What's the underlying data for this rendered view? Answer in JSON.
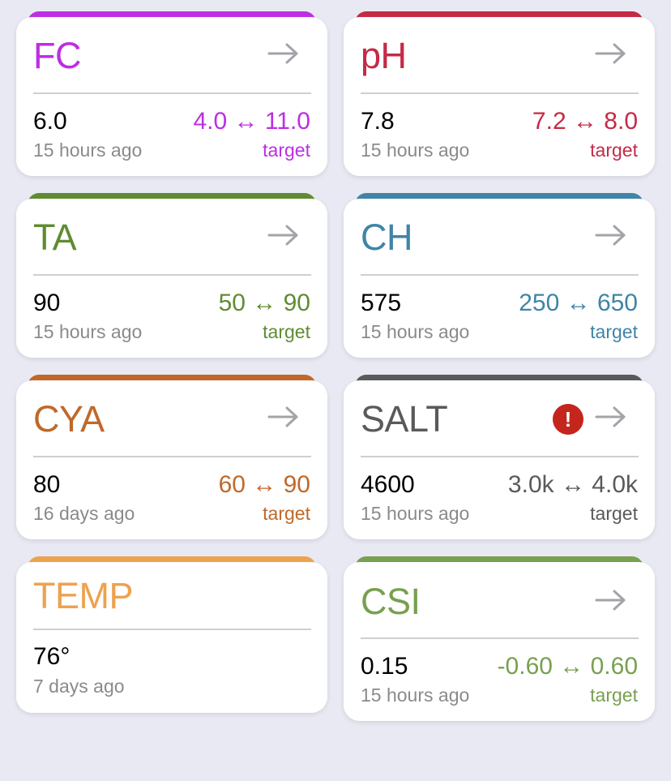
{
  "cards": [
    {
      "title": "FC",
      "value": "6.0",
      "ago": "15 hours ago",
      "range": "4.0 ↔ 11.0",
      "target": "target",
      "color": "#bd2ee4",
      "arrow_icon": "arrow-right-icon"
    },
    {
      "title": "pH",
      "value": "7.8",
      "ago": "15 hours ago",
      "range": "7.2 ↔ 8.0",
      "target": "target",
      "color": "#c42a46",
      "arrow_icon": "arrow-right-icon"
    },
    {
      "title": "TA",
      "value": "90",
      "ago": "15 hours ago",
      "range": "50 ↔ 90",
      "target": "target",
      "color": "#5f8c32",
      "arrow_icon": "arrow-right-icon"
    },
    {
      "title": "CH",
      "value": "575",
      "ago": "15 hours ago",
      "range": "250 ↔ 650",
      "target": "target",
      "color": "#3f85a6",
      "arrow_icon": "arrow-right-icon"
    },
    {
      "title": "CYA",
      "value": "80",
      "ago": "16 days ago",
      "range": "60 ↔ 90",
      "target": "target",
      "color": "#c0682a",
      "arrow_icon": "arrow-right-icon"
    },
    {
      "title": "SALT",
      "value": "4600",
      "ago": "15 hours ago",
      "range": "3.0k ↔ 4.0k",
      "target": "target",
      "color": "#5a5a5c",
      "alert": "!",
      "alert_icon": "alert-icon",
      "arrow_icon": "arrow-right-icon"
    },
    {
      "title": "TEMP",
      "value": "76°",
      "ago": "7 days ago",
      "color": "#eda24f"
    },
    {
      "title": "CSI",
      "value": "0.15",
      "ago": "15 hours ago",
      "range": "-0.60 ↔ 0.60",
      "target": "target",
      "color": "#78a050",
      "arrow_icon": "arrow-right-icon"
    }
  ]
}
